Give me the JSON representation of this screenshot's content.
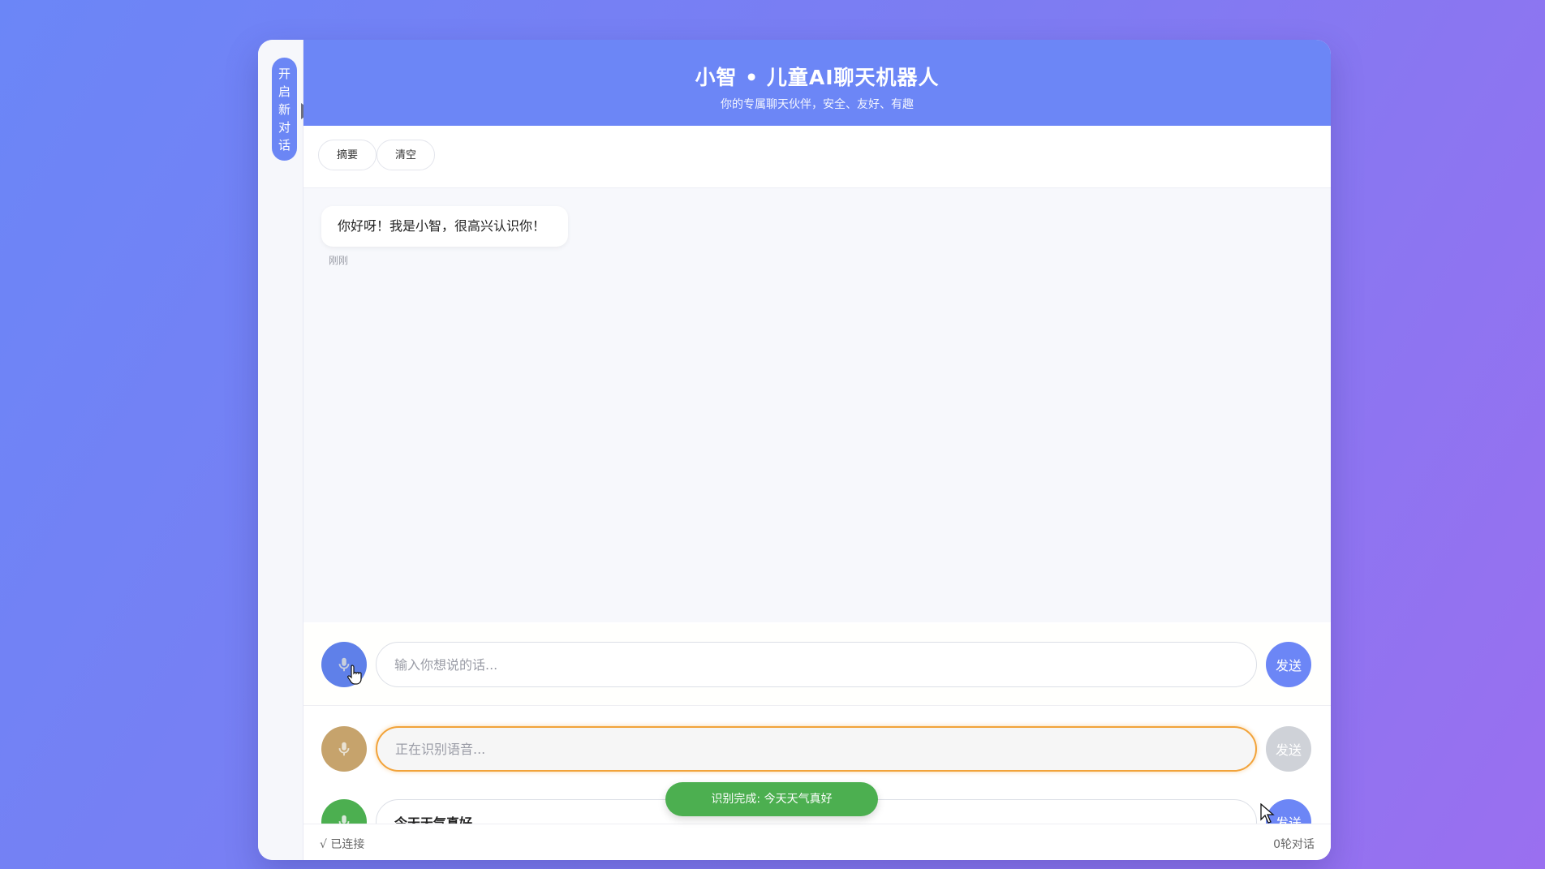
{
  "app": {
    "title": "小智 • 儿童AI聊天机器人",
    "subtitle": "你的专属聊天伙伴，安全、友好、有趣"
  },
  "sidebar": {
    "new_chat_label": "开启新对话"
  },
  "toolbar": {
    "summary_label": "摘要",
    "clear_label": "清空"
  },
  "messages": [
    {
      "text": "你好呀！我是小智，很高兴认识你！",
      "time": "刚刚"
    }
  ],
  "input_rows": [
    {
      "state": "idle",
      "mic_color": "#5f80e9",
      "placeholder": "输入你想说的话...",
      "value": "",
      "send_label": "发送",
      "send_color": "#6c86f6"
    },
    {
      "state": "recognizing",
      "mic_color": "#c6a36c",
      "placeholder": "正在识别语音...",
      "value": "",
      "send_label": "发送",
      "send_color": "#cfd2d8"
    },
    {
      "state": "recognized",
      "mic_color": "#4caf50",
      "placeholder": "",
      "value": "今天天气真好",
      "send_label": "发送",
      "send_color": "#6c86f6"
    }
  ],
  "toast": "识别完成: 今天天气真好",
  "status": {
    "connection": "√ 已连接",
    "turns": "0轮对话"
  },
  "colors": {
    "accent": "#6c86f6",
    "recognizing": "#f2a33a",
    "success": "#4caf50"
  },
  "icons": {
    "mic": "microphone-icon",
    "arrow": "collapse-arrow-icon"
  }
}
